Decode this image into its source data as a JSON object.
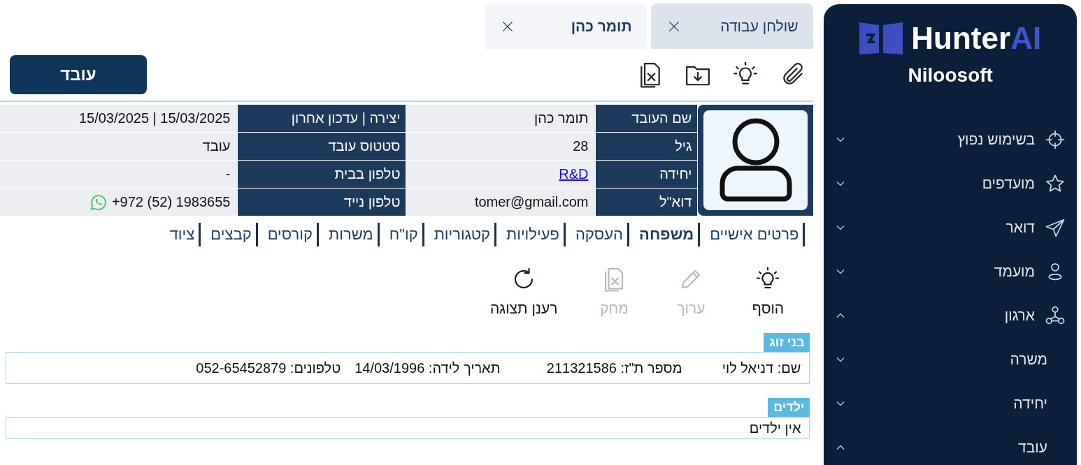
{
  "sidebar": {
    "logo": {
      "text": "Hunter",
      "accent": "AI"
    },
    "company": "Niloosoft",
    "items": [
      {
        "label": "בשימוש נפוץ",
        "expanded": false
      },
      {
        "label": "מועדפים",
        "expanded": false
      },
      {
        "label": "דואר",
        "expanded": false
      },
      {
        "label": "מועמד",
        "expanded": false
      },
      {
        "label": "ארגון",
        "expanded": true,
        "children": [
          {
            "label": "משרה",
            "expanded": false
          },
          {
            "label": "יחידה",
            "expanded": false
          },
          {
            "label": "עובד",
            "expanded": true
          }
        ]
      }
    ]
  },
  "tabs": [
    {
      "label": "שולחן עבודה",
      "selected": false
    },
    {
      "label": "תומר כהן",
      "selected": true
    }
  ],
  "toolbar": {
    "button": "עובד"
  },
  "profile": {
    "rows": [
      {
        "fields": [
          {
            "label": "שם העובד",
            "value": "תומר כהן",
            "kind": "text"
          },
          {
            "label": "יצירה | עדכון אחרון",
            "value": "15/03/2025 | 15/03/2025",
            "kind": "text"
          }
        ]
      },
      {
        "fields": [
          {
            "label": "גיל",
            "value": "28",
            "kind": "text"
          },
          {
            "label": "סטטוס עובד",
            "value": "עובד",
            "kind": "text"
          }
        ]
      },
      {
        "fields": [
          {
            "label": "יחידה",
            "value": "R&D",
            "kind": "link"
          },
          {
            "label": "טלפון בבית",
            "value": "-",
            "kind": "text"
          }
        ]
      },
      {
        "fields": [
          {
            "label": "דוא\"ל",
            "value": "tomer@gmail.com",
            "kind": "text"
          },
          {
            "label": "טלפון נייד",
            "value": "+972 (52) 1983655",
            "kind": "phone"
          }
        ]
      }
    ]
  },
  "section_tabs": [
    {
      "label": "פרטים אישיים",
      "selected": false
    },
    {
      "label": "משפחה",
      "selected": true
    },
    {
      "label": "העסקה",
      "selected": false
    },
    {
      "label": "פעילויות",
      "selected": false
    },
    {
      "label": "קטגוריות",
      "selected": false
    },
    {
      "label": "קו\"ח",
      "selected": false
    },
    {
      "label": "משרות",
      "selected": false
    },
    {
      "label": "קורסים",
      "selected": false
    },
    {
      "label": "קבצים",
      "selected": false
    },
    {
      "label": "ציוד",
      "selected": false
    }
  ],
  "actions": [
    {
      "label": "הוסף",
      "disabled": false
    },
    {
      "label": "ערוך",
      "disabled": true
    },
    {
      "label": "מחק",
      "disabled": true
    },
    {
      "label": "רענן תצוגה",
      "disabled": false
    }
  ],
  "sections": [
    {
      "title": "בני זוג",
      "entries": [
        "שם: דניאל לוי",
        "מספר ת\"ז: 211321586",
        "תאריך לידה: 14/03/1996",
        "טלפונים: 052-65452879"
      ]
    },
    {
      "title": "ילדים",
      "entries": [
        "אין ילדים"
      ]
    }
  ]
}
